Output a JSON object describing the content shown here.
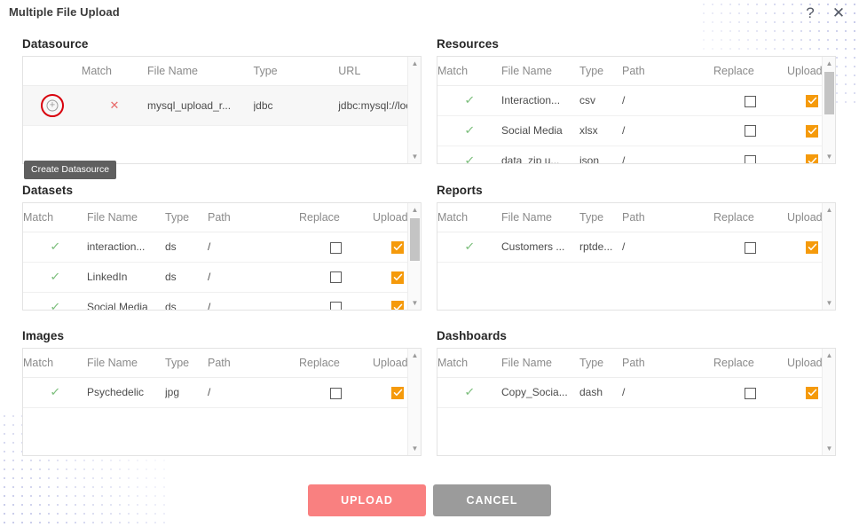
{
  "dialog": {
    "title": "Multiple File Upload",
    "help_icon": "?",
    "close_icon": "✕",
    "tooltip": "Create Datasource"
  },
  "icons": {
    "tick": "✓",
    "cross": "✕",
    "plus": "+",
    "arrow_up": "▲",
    "arrow_down": "▼"
  },
  "colors": {
    "accent_orange": "#f59a0b",
    "upload_button": "#f98080",
    "cancel_button": "#9b9b9b",
    "tick_green": "#7dbf7d",
    "cross_red": "#e86a6a",
    "ring_red": "#d8000c",
    "dots": "#b9bde4"
  },
  "sections": {
    "datasource": {
      "title": "Datasource",
      "columns": [
        "",
        "Match",
        "File Name",
        "Type",
        "URL"
      ],
      "rows": [
        {
          "action": "create-datasource",
          "match": "cross",
          "file_name": "mysql_upload_r...",
          "type": "jdbc",
          "url": "jdbc:mysql://loc..."
        }
      ]
    },
    "resources": {
      "title": "Resources",
      "columns": [
        "Match",
        "File Name",
        "Type",
        "Path",
        "Replace",
        "Upload"
      ],
      "rows": [
        {
          "match": "tick",
          "file_name": "Interaction...",
          "type": "csv",
          "path": "/",
          "replace": false,
          "upload": true
        },
        {
          "match": "tick",
          "file_name": "Social Media",
          "type": "xlsx",
          "path": "/",
          "replace": false,
          "upload": true
        },
        {
          "match": "tick",
          "file_name": "data_zip u...",
          "type": "json",
          "path": "/",
          "replace": false,
          "upload": true
        }
      ]
    },
    "datasets": {
      "title": "Datasets",
      "columns": [
        "Match",
        "File Name",
        "Type",
        "Path",
        "Replace",
        "Upload"
      ],
      "rows": [
        {
          "match": "tick",
          "file_name": "interaction...",
          "type": "ds",
          "path": "/",
          "replace": false,
          "upload": true
        },
        {
          "match": "tick",
          "file_name": "LinkedIn",
          "type": "ds",
          "path": "/",
          "replace": false,
          "upload": true
        },
        {
          "match": "tick",
          "file_name": "Social Media",
          "type": "ds",
          "path": "/",
          "replace": false,
          "upload": true
        }
      ]
    },
    "reports": {
      "title": "Reports",
      "columns": [
        "Match",
        "File Name",
        "Type",
        "Path",
        "Replace",
        "Upload"
      ],
      "rows": [
        {
          "match": "tick",
          "file_name": "Customers ...",
          "type": "rptde...",
          "path": "/",
          "replace": false,
          "upload": true
        }
      ]
    },
    "images": {
      "title": "Images",
      "columns": [
        "Match",
        "File Name",
        "Type",
        "Path",
        "Replace",
        "Upload"
      ],
      "rows": [
        {
          "match": "tick",
          "file_name": "Psychedelic",
          "type": "jpg",
          "path": "/",
          "replace": false,
          "upload": true
        }
      ]
    },
    "dashboards": {
      "title": "Dashboards",
      "columns": [
        "Match",
        "File Name",
        "Type",
        "Path",
        "Replace",
        "Upload"
      ],
      "rows": [
        {
          "match": "tick",
          "file_name": "Copy_Socia...",
          "type": "dash",
          "path": "/",
          "replace": false,
          "upload": true
        }
      ]
    }
  },
  "footer": {
    "upload_label": "UPLOAD",
    "cancel_label": "CANCEL"
  }
}
